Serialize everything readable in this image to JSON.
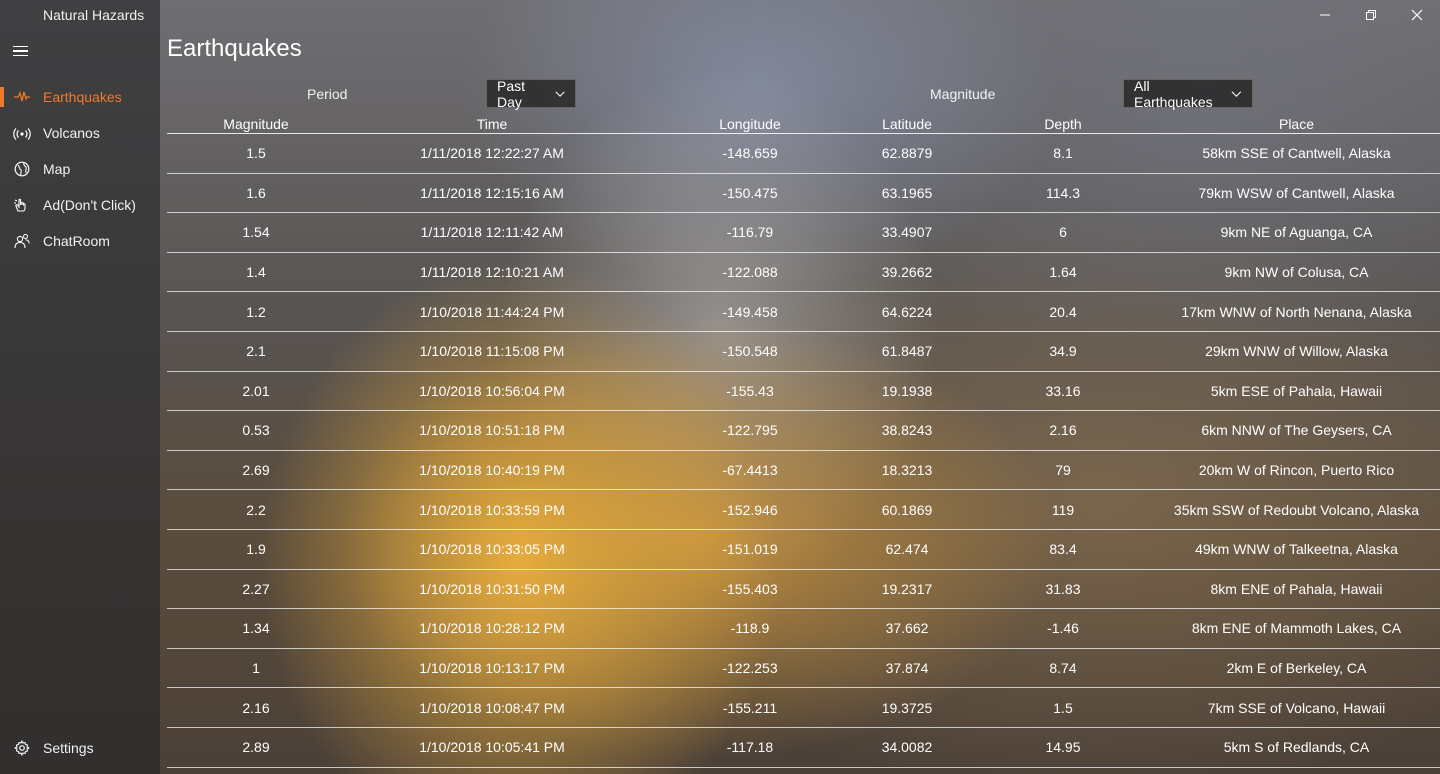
{
  "app": {
    "title": "Natural Hazards",
    "window_controls": [
      "minimize-icon",
      "restore-icon",
      "close-icon"
    ]
  },
  "sidebar": {
    "items": [
      {
        "label": "Earthquakes",
        "icon": "seismograph-icon",
        "active": true
      },
      {
        "label": "Volcanos",
        "icon": "broadcast-icon",
        "active": false
      },
      {
        "label": "Map",
        "icon": "globe-icon",
        "active": false
      },
      {
        "label": "Ad(Don't Click)",
        "icon": "pointer-hand-icon",
        "active": false
      },
      {
        "label": "ChatRoom",
        "icon": "people-icon",
        "active": false
      }
    ],
    "settings": {
      "label": "Settings",
      "icon": "gear-icon"
    }
  },
  "main": {
    "title": "Earthquakes",
    "filters": {
      "period_label": "Period",
      "period_value": "Past Day",
      "magnitude_label": "Magnitude",
      "magnitude_value": "All Earthquakes"
    },
    "columns": [
      "Magnitude",
      "Time",
      "Longitude",
      "Latitude",
      "Depth",
      "Place"
    ],
    "rows": [
      [
        "1.5",
        "1/11/2018 12:22:27 AM",
        "-148.659",
        "62.8879",
        "8.1",
        "58km SSE of Cantwell, Alaska"
      ],
      [
        "1.6",
        "1/11/2018 12:15:16 AM",
        "-150.475",
        "63.1965",
        "114.3",
        "79km WSW of Cantwell, Alaska"
      ],
      [
        "1.54",
        "1/11/2018 12:11:42 AM",
        "-116.79",
        "33.4907",
        "6",
        "9km NE of Aguanga, CA"
      ],
      [
        "1.4",
        "1/11/2018 12:10:21 AM",
        "-122.088",
        "39.2662",
        "1.64",
        "9km NW of Colusa, CA"
      ],
      [
        "1.2",
        "1/10/2018 11:44:24 PM",
        "-149.458",
        "64.6224",
        "20.4",
        "17km WNW of North Nenana, Alaska"
      ],
      [
        "2.1",
        "1/10/2018 11:15:08 PM",
        "-150.548",
        "61.8487",
        "34.9",
        "29km WNW of Willow, Alaska"
      ],
      [
        "2.01",
        "1/10/2018 10:56:04 PM",
        "-155.43",
        "19.1938",
        "33.16",
        "5km ESE of Pahala, Hawaii"
      ],
      [
        "0.53",
        "1/10/2018 10:51:18 PM",
        "-122.795",
        "38.8243",
        "2.16",
        "6km NNW of The Geysers, CA"
      ],
      [
        "2.69",
        "1/10/2018 10:40:19 PM",
        "-67.4413",
        "18.3213",
        "79",
        "20km W of Rincon, Puerto Rico"
      ],
      [
        "2.2",
        "1/10/2018 10:33:59 PM",
        "-152.946",
        "60.1869",
        "119",
        "35km SSW of Redoubt Volcano, Alaska"
      ],
      [
        "1.9",
        "1/10/2018 10:33:05 PM",
        "-151.019",
        "62.474",
        "83.4",
        "49km WNW of Talkeetna, Alaska"
      ],
      [
        "2.27",
        "1/10/2018 10:31:50 PM",
        "-155.403",
        "19.2317",
        "31.83",
        "8km ENE of Pahala, Hawaii"
      ],
      [
        "1.34",
        "1/10/2018 10:28:12 PM",
        "-118.9",
        "37.662",
        "-1.46",
        "8km ENE of Mammoth Lakes, CA"
      ],
      [
        "1",
        "1/10/2018 10:13:17 PM",
        "-122.253",
        "37.874",
        "8.74",
        "2km E of Berkeley, CA"
      ],
      [
        "2.16",
        "1/10/2018 10:08:47 PM",
        "-155.211",
        "19.3725",
        "1.5",
        "7km SSE of Volcano, Hawaii"
      ],
      [
        "2.89",
        "1/10/2018 10:05:41 PM",
        "-117.18",
        "34.0082",
        "14.95",
        "5km S of Redlands, CA"
      ]
    ]
  },
  "colors": {
    "accent": "#f07a2c"
  }
}
